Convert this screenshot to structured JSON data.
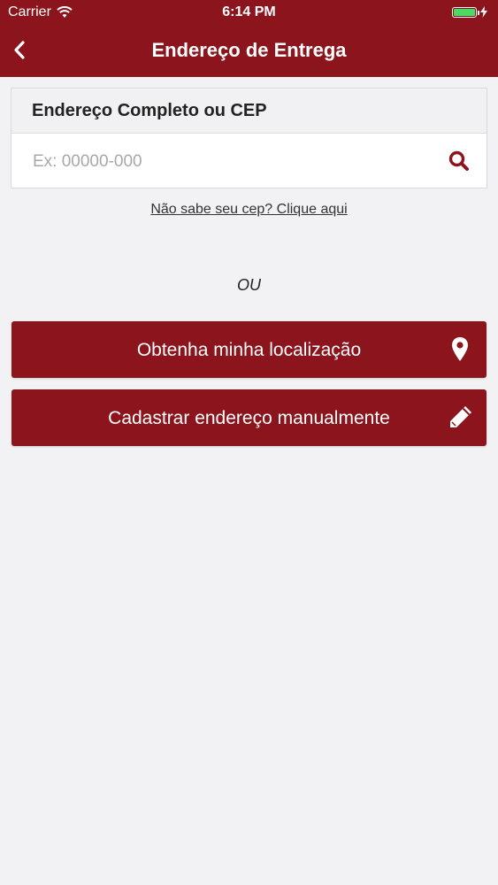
{
  "status_bar": {
    "carrier": "Carrier",
    "time": "6:14 PM",
    "battery_level": 1.0,
    "battery_color": "#4cd964"
  },
  "navbar": {
    "title": "Endereço de Entrega",
    "back_icon": "chevron-left-icon",
    "background": "#8c141c"
  },
  "address_card": {
    "header": "Endereço Completo ou CEP",
    "input_value": "",
    "input_placeholder": "Ex: 00000-000",
    "search_icon": "search-icon"
  },
  "cep_help_link": "Não sabe seu cep? Clique aqui",
  "separator": "OU",
  "buttons": {
    "location_label": "Obtenha minha localização",
    "location_icon": "map-pin-icon",
    "manual_label": "Cadastrar endereço manualmente",
    "manual_icon": "pencil-icon"
  },
  "colors": {
    "accent": "#8c141c",
    "background": "#f2f2f4"
  }
}
